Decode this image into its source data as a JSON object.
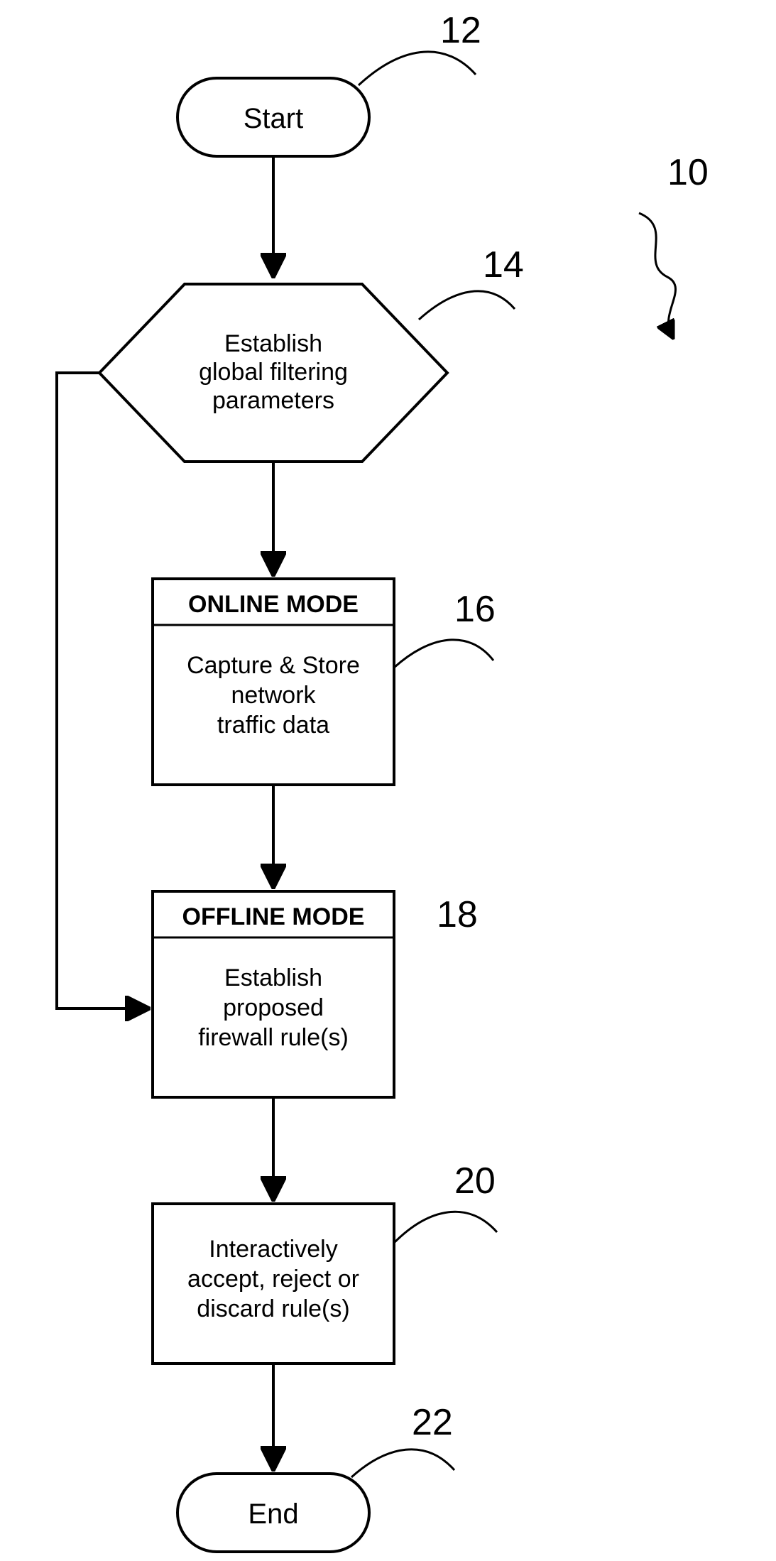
{
  "diagram": {
    "overall_ref": "10",
    "nodes": {
      "start": {
        "ref": "12",
        "text": "Start"
      },
      "params": {
        "ref": "14",
        "lines": [
          "Establish",
          "global filtering",
          "parameters"
        ]
      },
      "online": {
        "ref": "16",
        "header": "ONLINE MODE",
        "lines": [
          "Capture & Store",
          "network",
          "traffic data"
        ]
      },
      "offline": {
        "ref": "18",
        "header": "OFFLINE MODE",
        "lines": [
          "Establish",
          "proposed",
          "firewall rule(s)"
        ]
      },
      "review": {
        "ref": "20",
        "lines": [
          "Interactively",
          "accept, reject or",
          "discard rule(s)"
        ]
      },
      "end": {
        "ref": "22",
        "text": "End"
      }
    }
  }
}
